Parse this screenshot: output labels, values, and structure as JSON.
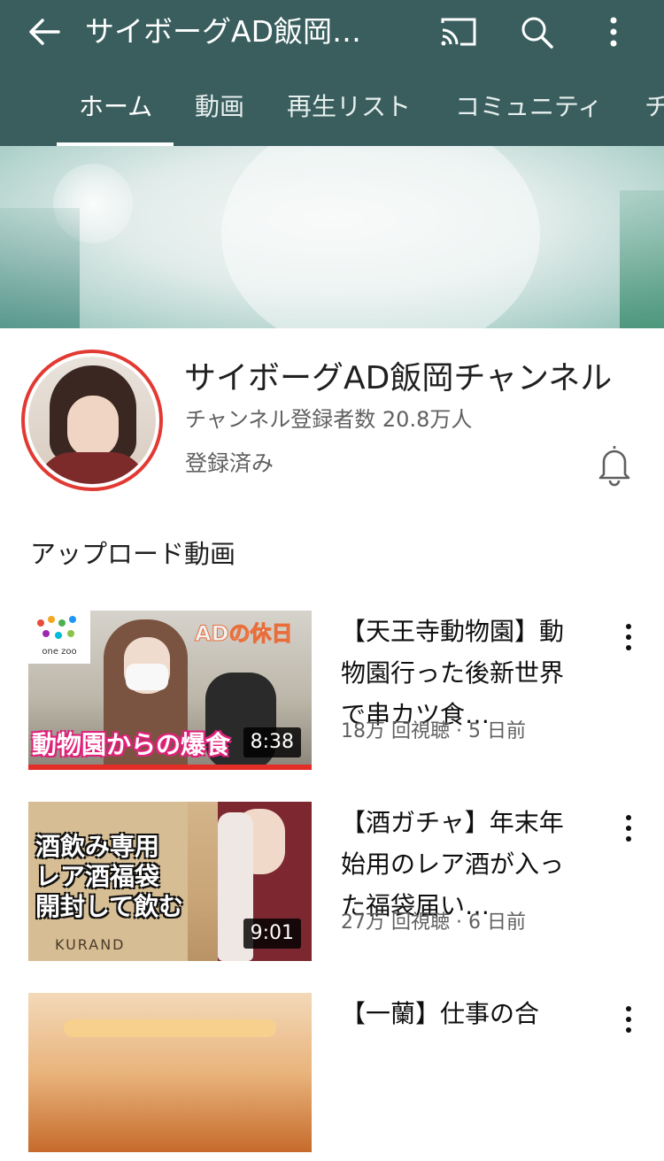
{
  "colors": {
    "appbar": "#3a5e5e",
    "avatar_ring": "#e23a33",
    "progress": "#e52d27"
  },
  "header": {
    "title": "サイボーグAD飯岡…",
    "back_icon": "arrow-left-icon",
    "cast_icon": "cast-icon",
    "search_icon": "search-icon",
    "more_icon": "more-vertical-icon"
  },
  "tabs": [
    {
      "label": "ホーム",
      "active": true
    },
    {
      "label": "動画"
    },
    {
      "label": "再生リスト"
    },
    {
      "label": "コミュニティ"
    },
    {
      "label": "チ"
    }
  ],
  "channel": {
    "name": "サイボーグAD飯岡チャンネル",
    "subscribers": "チャンネル登録者数 20.8万人",
    "subscribed_label": "登録済み",
    "bell_icon": "bell-icon"
  },
  "section": {
    "title": "アップロード動画"
  },
  "videos": [
    {
      "title": "【天王寺動物園】動物園行った後新世界で串カツ食…",
      "meta": "18万 回視聴 · 5 日前",
      "duration": "8:38",
      "thumb_text_1": "ADの休日",
      "thumb_text_2": "動物園からの爆食",
      "thumb_logo": "one zoo",
      "watched_fraction": 1.0
    },
    {
      "title": "【酒ガチャ】年末年始用のレア酒が入った福袋届い…",
      "meta": "27万 回視聴 · 6 日前",
      "duration": "9:01",
      "thumb_text_1": "酒飲み専用\nレア酒福袋\n開封して飲む",
      "thumb_text_2": "KURAND"
    },
    {
      "title": "【一蘭】仕事の合",
      "meta": "",
      "duration": ""
    }
  ]
}
